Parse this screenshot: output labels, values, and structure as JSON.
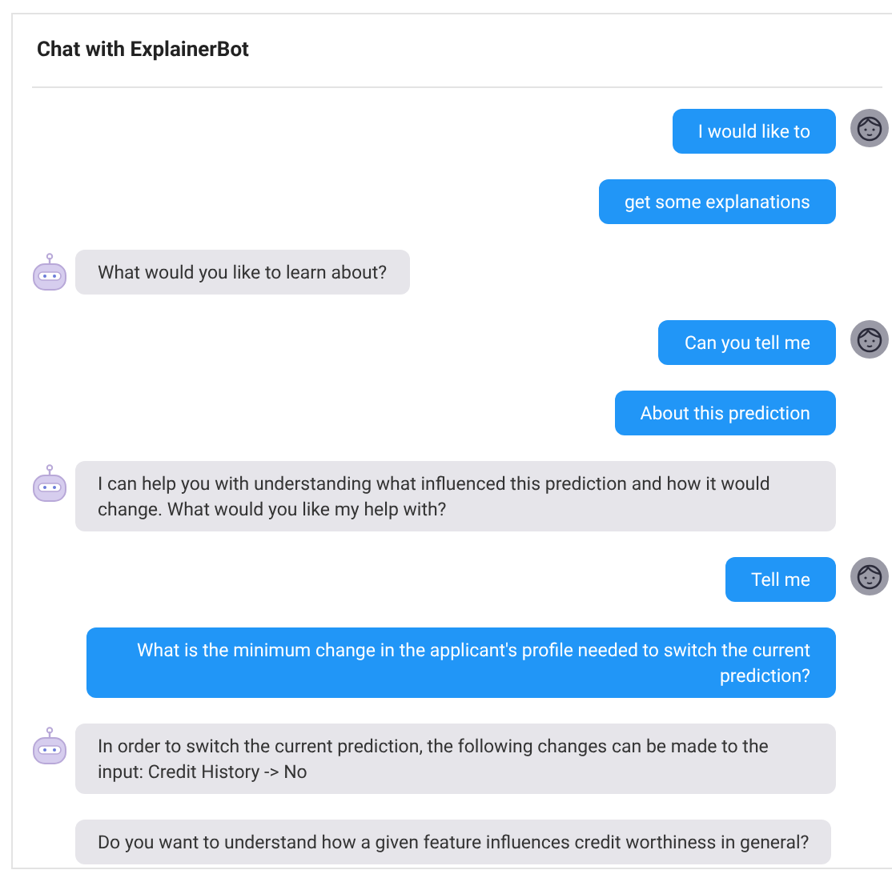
{
  "title": "Chat with ExplainerBot",
  "messages": [
    {
      "kind": "user",
      "avatar": true,
      "text": "I would like to"
    },
    {
      "kind": "user",
      "avatar": false,
      "text": "get some explanations"
    },
    {
      "kind": "bot",
      "avatar": true,
      "text": "What would you like to learn about?"
    },
    {
      "kind": "user",
      "avatar": true,
      "text": "Can you tell me"
    },
    {
      "kind": "user",
      "avatar": false,
      "text": "About this prediction"
    },
    {
      "kind": "bot",
      "avatar": true,
      "text": "I can help you with understanding what influenced this prediction and how it would change. What would you like my help with?"
    },
    {
      "kind": "user",
      "avatar": true,
      "text": "Tell me"
    },
    {
      "kind": "user",
      "avatar": false,
      "text": "What is the minimum change in the applicant's profile needed to switch the current prediction?"
    },
    {
      "kind": "bot",
      "avatar": true,
      "text": "In order to switch the current prediction, the following changes can be made to the input: Credit History -> No"
    },
    {
      "kind": "bot",
      "avatar": false,
      "text": "Do you want to understand how a given feature influences credit worthiness in general?"
    }
  ]
}
